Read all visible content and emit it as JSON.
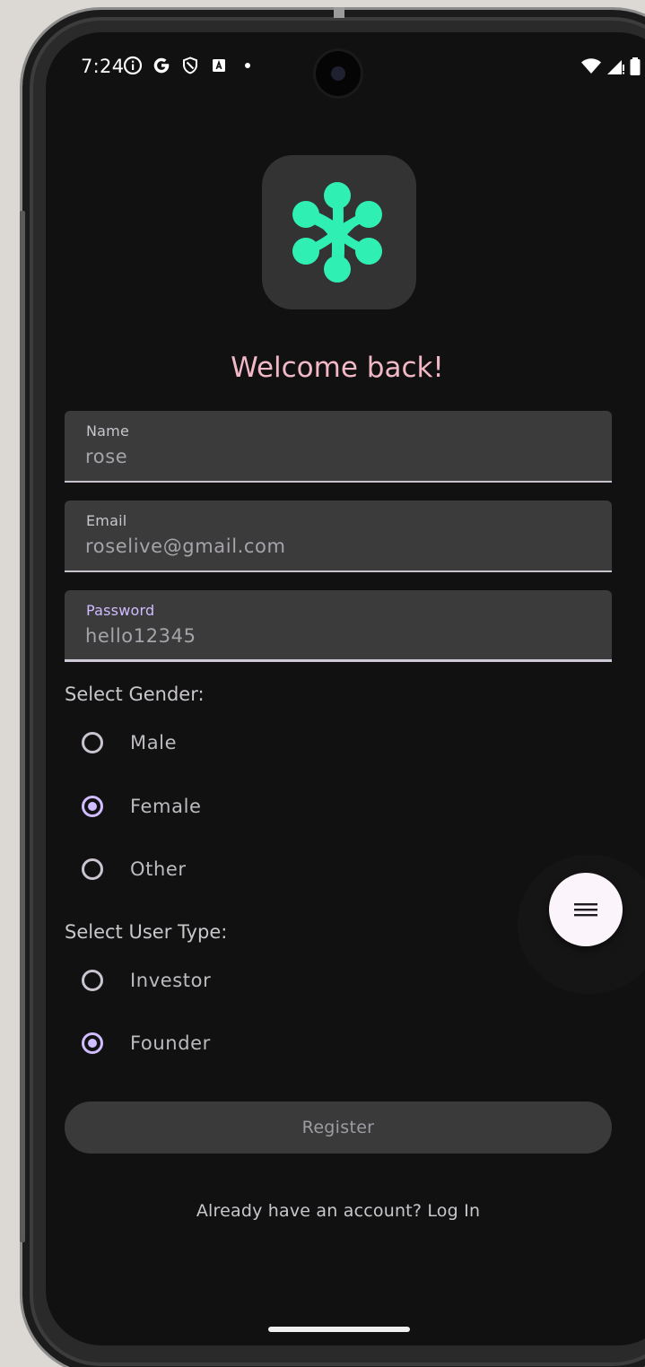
{
  "status_bar": {
    "time": "7:24",
    "left_icons": [
      "info-icon",
      "google-icon",
      "shield-icon",
      "a-box-icon",
      "dot-icon"
    ],
    "right_icons": [
      "wifi-icon",
      "signal-icon",
      "battery-icon"
    ]
  },
  "logo": {
    "icon": "molecule-logo-icon",
    "color": "#2ff0b2",
    "tile_color": "#333333"
  },
  "header": {
    "title": "Welcome back!",
    "title_color": "#f2b8c6"
  },
  "form": {
    "name": {
      "label": "Name",
      "value": "rose"
    },
    "email": {
      "label": "Email",
      "value": "roselive@gmail.com"
    },
    "password": {
      "label": "Password",
      "value": "hello12345",
      "focused": true
    },
    "gender": {
      "label": "Select Gender:",
      "options": [
        {
          "label": "Male",
          "selected": false
        },
        {
          "label": "Female",
          "selected": true
        },
        {
          "label": "Other",
          "selected": false
        }
      ]
    },
    "user_type": {
      "label": "Select User Type:",
      "options": [
        {
          "label": "Investor",
          "selected": false
        },
        {
          "label": "Founder",
          "selected": true
        }
      ]
    },
    "register_label": "Register",
    "login_prompt": "Already have an account? Log In"
  },
  "fab": {
    "icon": "menu-icon"
  },
  "colors": {
    "accent": "#d0bcff",
    "background": "#111111",
    "field_background": "#3b3b3b"
  }
}
